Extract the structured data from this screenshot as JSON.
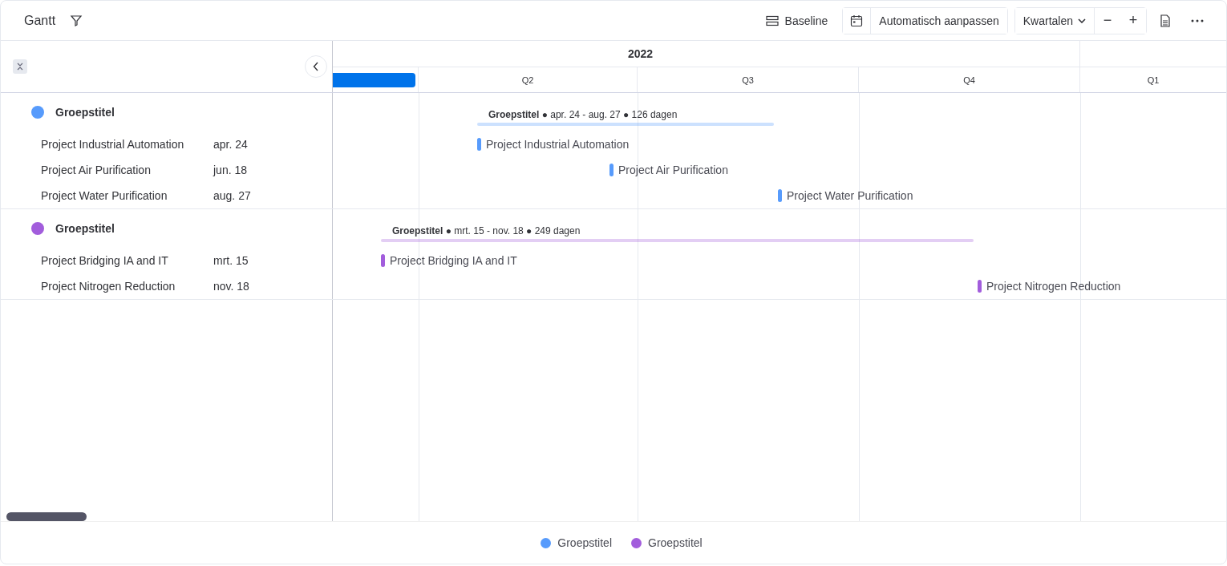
{
  "header": {
    "title": "Gantt",
    "baseline": "Baseline",
    "auto_fit": "Automatisch aanpassen",
    "zoom_level": "Kwartalen",
    "zoom_out": "−",
    "zoom_in": "+"
  },
  "timeline": {
    "year": "2022",
    "quarters": [
      "Q2",
      "Q3",
      "Q4",
      "Q1"
    ]
  },
  "groups": [
    {
      "title": "Groepstitel",
      "color": "#579bfc",
      "summary": "**Groepstitel** ● apr. 24 - aug. 27 ● 126 dagen",
      "tasks": [
        {
          "name": "Project Industrial Automation",
          "date": "apr. 24",
          "bar_label": "Project Industrial Automation"
        },
        {
          "name": "Project Air Purification",
          "date": "jun. 18",
          "bar_label": "Project Air Purification"
        },
        {
          "name": "Project Water Purification",
          "date": "aug. 27",
          "bar_label": "Project Water Purification"
        }
      ]
    },
    {
      "title": "Groepstitel",
      "color": "#a25ddc",
      "summary": "**Groepstitel** ● mrt. 15 - nov. 18 ● 249 dagen",
      "tasks": [
        {
          "name": "Project Bridging IA and IT",
          "date": "mrt. 15",
          "bar_label": "Project Bridging IA and IT"
        },
        {
          "name": "Project Nitrogen Reduction",
          "date": "nov. 18",
          "bar_label": "Project Nitrogen Reduction"
        }
      ]
    }
  ],
  "legend": [
    {
      "label": "Groepstitel",
      "color": "#579bfc"
    },
    {
      "label": "Groepstitel",
      "color": "#a25ddc"
    }
  ]
}
